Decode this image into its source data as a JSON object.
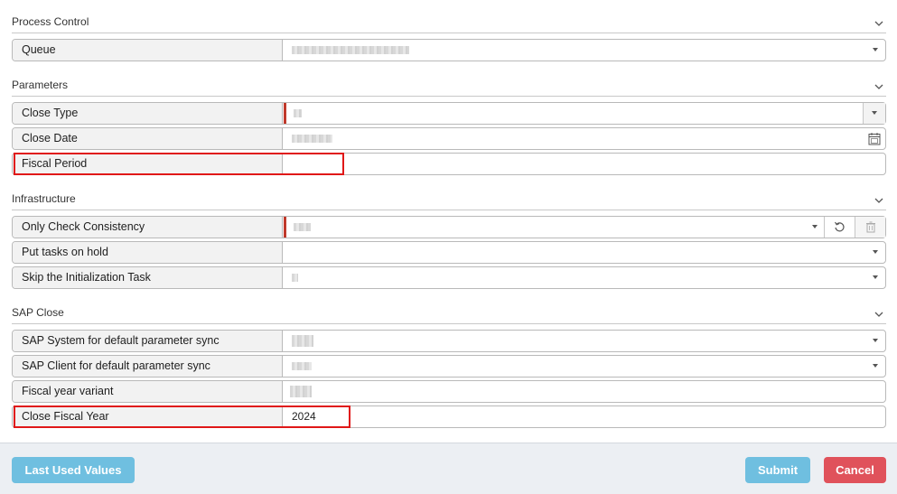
{
  "sections": {
    "process_control": {
      "title": "Process Control"
    },
    "parameters": {
      "title": "Parameters"
    },
    "infrastructure": {
      "title": "Infrastructure"
    },
    "sap_close": {
      "title": "SAP Close"
    }
  },
  "fields": {
    "queue": {
      "label": "Queue"
    },
    "close_type": {
      "label": "Close Type"
    },
    "close_date": {
      "label": "Close Date"
    },
    "fiscal_period": {
      "label": "Fiscal Period",
      "value": ""
    },
    "only_check_consistency": {
      "label": "Only Check Consistency"
    },
    "put_tasks_on_hold": {
      "label": "Put tasks on hold"
    },
    "skip_init_task": {
      "label": "Skip the Initialization Task"
    },
    "sap_system": {
      "label": "SAP System for default parameter sync"
    },
    "sap_client": {
      "label": "SAP Client for default parameter sync"
    },
    "fiscal_year_variant": {
      "label": "Fiscal year variant"
    },
    "close_fiscal_year": {
      "label": "Close Fiscal Year",
      "value": "2024"
    }
  },
  "buttons": {
    "last_used_values": "Last Used Values",
    "submit": "Submit",
    "cancel": "Cancel"
  },
  "colors": {
    "primary_button": "#6fbfe0",
    "cancel_button": "#e0525b",
    "required_marker": "#c0392b",
    "highlight": "#e01818"
  }
}
